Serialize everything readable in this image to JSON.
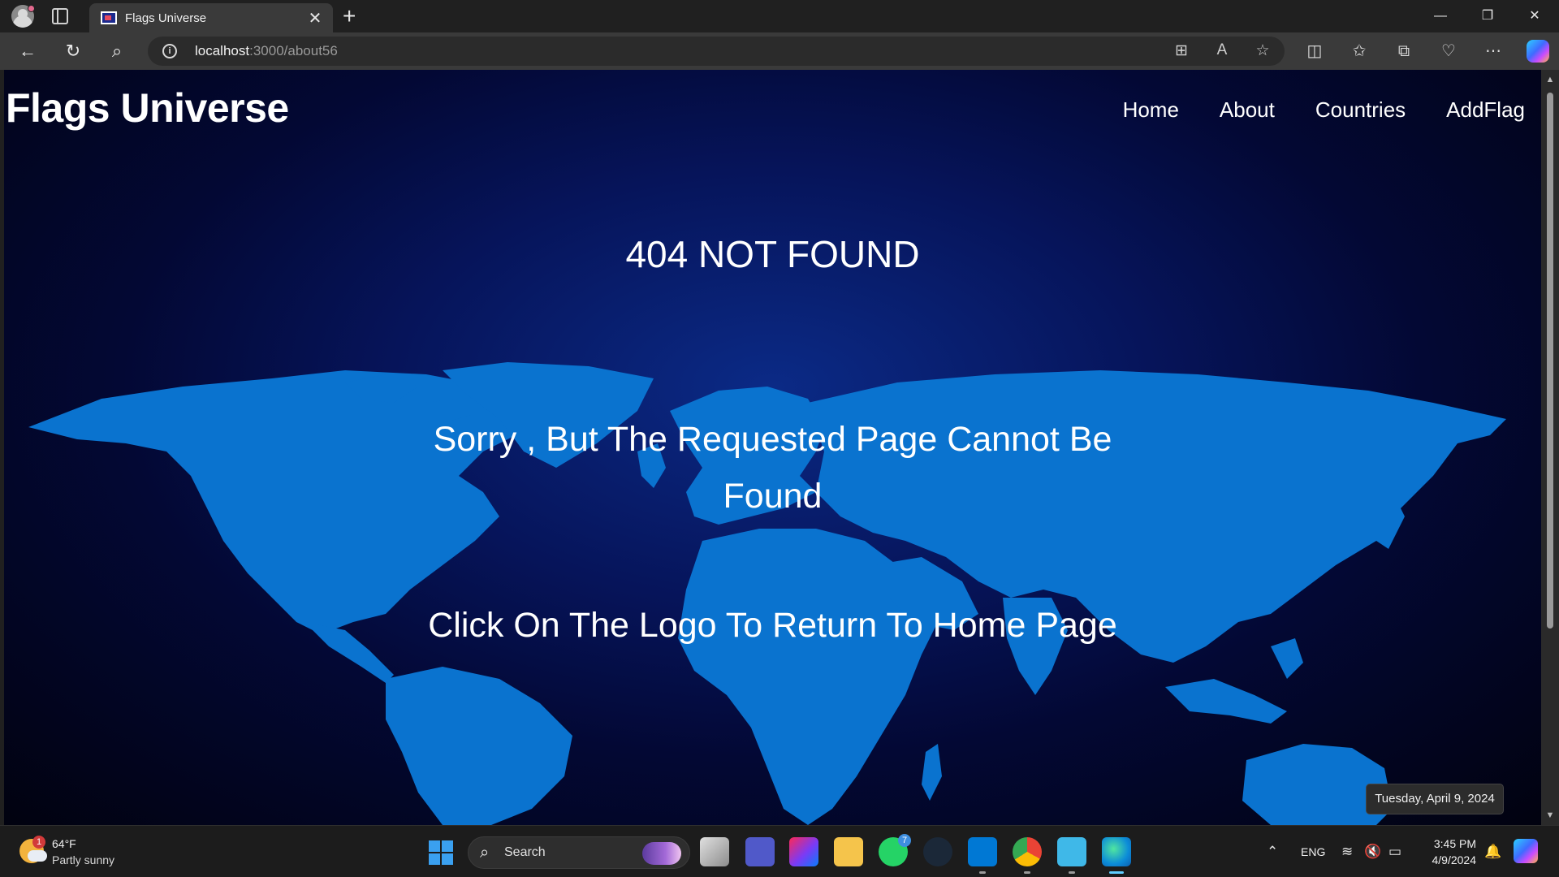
{
  "browser": {
    "tab_title": "Flags Universe",
    "tab_close": "✕",
    "new_tab": "+",
    "url_host": "localhost",
    "url_path": ":3000/about56",
    "minimize": "—",
    "restore": "❐",
    "close": "✕"
  },
  "page": {
    "logo": "Flags Universe",
    "nav": [
      "Home",
      "About",
      "Countries",
      "AddFlag"
    ],
    "error_code": "404 NOT FOUND",
    "message_line1": "Sorry , But The Requested Page Cannot Be",
    "message_line2": "Found",
    "hint": "Click On The Logo To Return To Home Page"
  },
  "tooltip": {
    "date": "Tuesday, April 9, 2024"
  },
  "taskbar": {
    "weather_temp": "64°F",
    "weather_desc": "Partly sunny",
    "weather_badge": "1",
    "search_label": "Search",
    "whatsapp_badge": "7",
    "language": "ENG",
    "time": "3:45 PM",
    "date": "4/9/2024"
  },
  "colors": {
    "map_land": "#0a73cf",
    "page_bg_center": "#0b2a86",
    "page_bg_edge": "#01020f",
    "accent": "#60cdff"
  }
}
